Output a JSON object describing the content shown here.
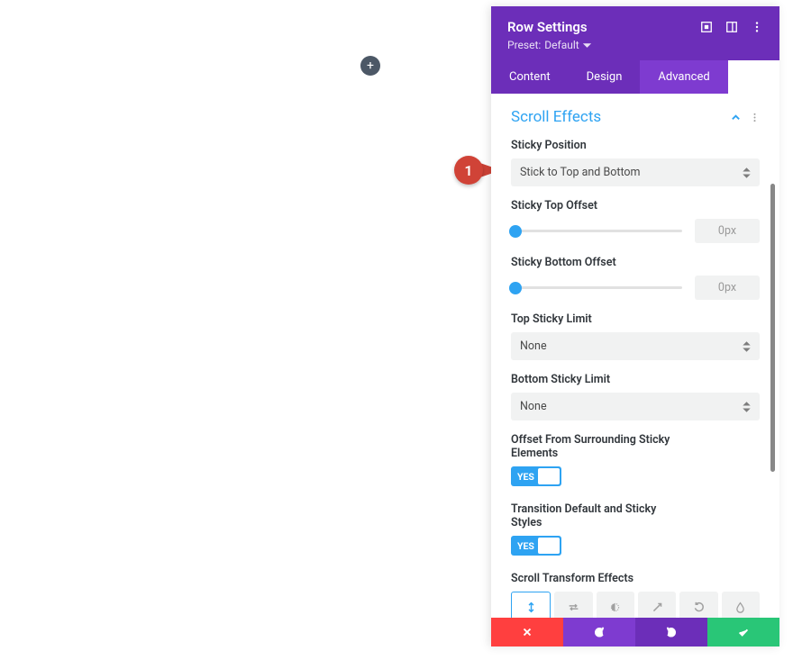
{
  "annotation": {
    "step": "1"
  },
  "header": {
    "title": "Row Settings",
    "preset_prefix": "Preset:",
    "preset_value": "Default"
  },
  "tabs": {
    "content": "Content",
    "design": "Design",
    "advanced": "Advanced",
    "active": "advanced"
  },
  "section": {
    "title": "Scroll Effects"
  },
  "fields": {
    "sticky_position": {
      "label": "Sticky Position",
      "value": "Stick to Top and Bottom"
    },
    "sticky_top_offset": {
      "label": "Sticky Top Offset",
      "value": "0px"
    },
    "sticky_bottom_offset": {
      "label": "Sticky Bottom Offset",
      "value": "0px"
    },
    "top_sticky_limit": {
      "label": "Top Sticky Limit",
      "value": "None"
    },
    "bottom_sticky_limit": {
      "label": "Bottom Sticky Limit",
      "value": "None"
    },
    "offset_surrounding": {
      "label": "Offset From Surrounding Sticky Elements",
      "value": "YES"
    },
    "transition_styles": {
      "label": "Transition Default and Sticky Styles",
      "value": "YES"
    },
    "scroll_transform": {
      "label": "Scroll Transform Effects"
    }
  },
  "transform_effects": [
    "vertical",
    "horizontal",
    "fade",
    "scale",
    "rotate",
    "blur"
  ],
  "colors": {
    "accent_purple": "#6c2eb9",
    "accent_blue": "#2ea3f2",
    "danger": "#ff3f3f",
    "success": "#29c677"
  }
}
